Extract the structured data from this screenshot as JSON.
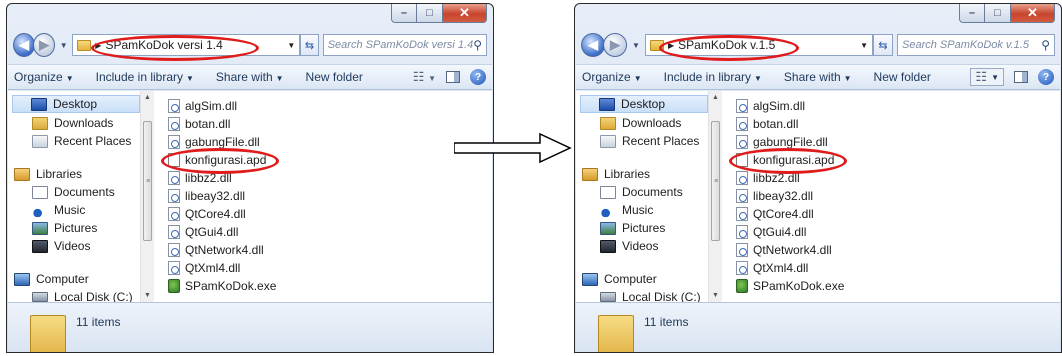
{
  "windows": [
    {
      "address_path": "SPamKoDok versi 1.4",
      "search_placeholder": "Search SPamKoDok versi 1.4",
      "toolbar": {
        "organize": "Organize",
        "include_in_library": "Include in library",
        "share_with": "Share with",
        "new_folder": "New folder"
      },
      "nav": [
        "Desktop",
        "Downloads",
        "Recent Places",
        "Libraries",
        "Documents",
        "Music",
        "Pictures",
        "Videos",
        "Computer",
        "Local Disk (C:)"
      ],
      "files": [
        "algSim.dll",
        "botan.dll",
        "gabungFile.dll",
        "konfigurasi.apd",
        "libbz2.dll",
        "libeay32.dll",
        "QtCore4.dll",
        "QtGui4.dll",
        "QtNetwork4.dll",
        "QtXml4.dll",
        "SPamKoDok.exe"
      ],
      "item_count": "11 items"
    },
    {
      "address_path": "SPamKoDok v.1.5",
      "search_placeholder": "Search SPamKoDok v.1.5",
      "toolbar": {
        "organize": "Organize",
        "include_in_library": "Include in library",
        "share_with": "Share with",
        "new_folder": "New folder"
      },
      "nav": [
        "Desktop",
        "Downloads",
        "Recent Places",
        "Libraries",
        "Documents",
        "Music",
        "Pictures",
        "Videos",
        "Computer",
        "Local Disk (C:)"
      ],
      "files": [
        "algSim.dll",
        "botan.dll",
        "gabungFile.dll",
        "konfigurasi.apd",
        "libbz2.dll",
        "libeay32.dll",
        "QtCore4.dll",
        "QtGui4.dll",
        "QtNetwork4.dll",
        "QtXml4.dll",
        "SPamKoDok.exe"
      ],
      "item_count": "11 items"
    }
  ],
  "highlight_color": "#e01b1b",
  "icons": {
    "minimize": "minimize-icon",
    "maximize": "maximize-icon",
    "close": "close-icon",
    "search": "search-icon",
    "help": "help-icon",
    "transition": "right-arrow-icon"
  }
}
